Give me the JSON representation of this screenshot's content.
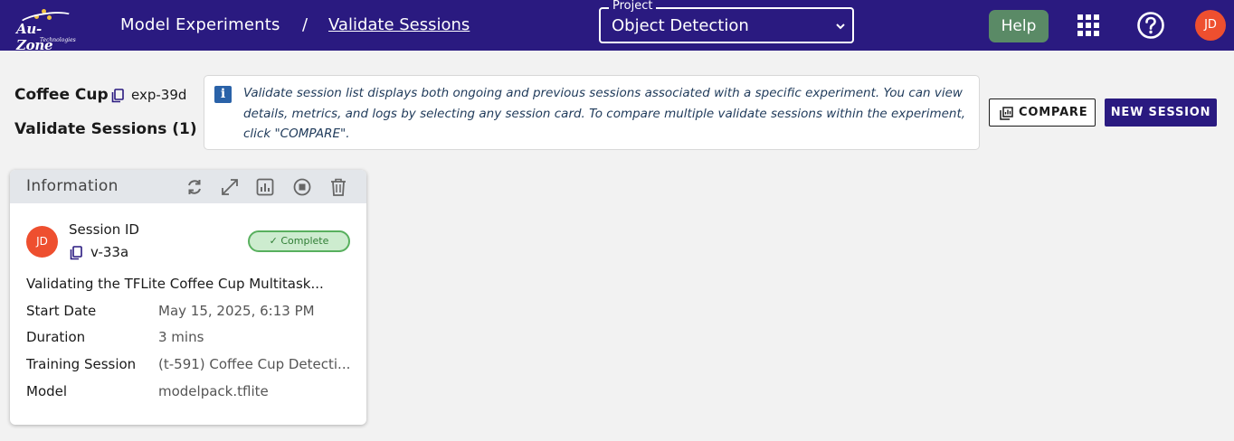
{
  "brand": {
    "name": "Au-Zone",
    "tagline": "Technologies"
  },
  "breadcrumb": {
    "root": "Model Experiments",
    "separator": "/",
    "current": "Validate Sessions"
  },
  "project_select": {
    "legend": "Project",
    "value": "Object Detection"
  },
  "header_actions": {
    "help_label": "Help",
    "user_initials": "JD"
  },
  "experiment": {
    "name": "Coffee Cup",
    "id": "exp-39d"
  },
  "sessions_title": "Validate Sessions (1)",
  "info_message": "Validate session list displays both ongoing and previous sessions associated with a specific experiment. You can view details, metrics, and logs by selecting any session card. To compare multiple validate sessions within the experiment, click \"COMPARE\".",
  "buttons": {
    "compare": "COMPARE",
    "new_session": "NEW SESSION"
  },
  "card": {
    "title": "Information",
    "avatar": "JD",
    "session_id_label": "Session ID",
    "session_id": "v-33a",
    "status": "✓ Complete",
    "description": "Validating the TFLite Coffee Cup Multitask...",
    "rows": [
      {
        "label": "Start Date",
        "value": "May 15, 2025, 6:13 PM"
      },
      {
        "label": "Duration",
        "value": "3 mins"
      },
      {
        "label": "Training Session",
        "value": "(t-591) Coffee Cup Detecti..."
      },
      {
        "label": "Model",
        "value": "modelpack.tflite"
      }
    ]
  },
  "colors": {
    "nav": "#2a1a80",
    "help": "#5a8a66",
    "avatar": "#ee4f2f",
    "complete_fill": "#cdeccf",
    "complete_border": "#58b05e",
    "info_badge": "#2a62a8"
  }
}
